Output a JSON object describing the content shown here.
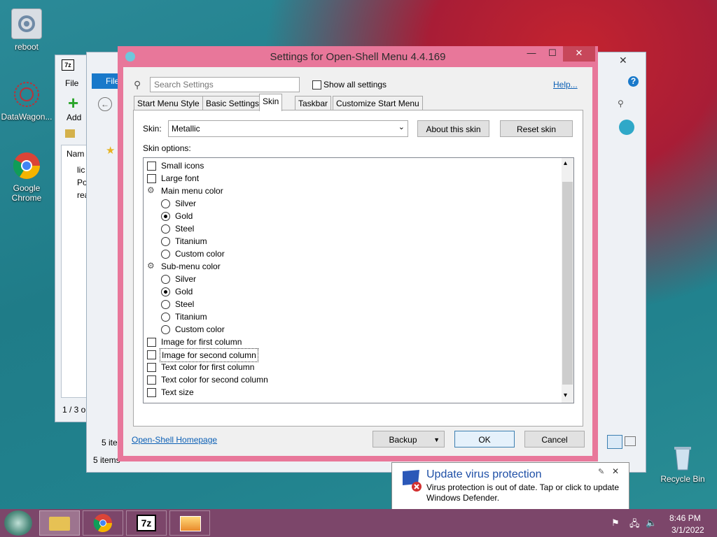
{
  "desktop": {
    "icons": [
      {
        "label": "reboot"
      },
      {
        "label": "DataWagon..."
      },
      {
        "label": "Google Chrome"
      },
      {
        "label": "Recycle Bin"
      }
    ]
  },
  "bg_window1": {
    "menu_file": "File",
    "add_label": "Add",
    "col_name": "Nam",
    "files": [
      "lic",
      "Po",
      "rea"
    ],
    "status": "1 / 3 o"
  },
  "bg_window2": {
    "menu_file": "File",
    "status1": "5 ite",
    "status2": "5 items"
  },
  "dialog": {
    "title": "Settings for Open-Shell Menu 4.4.169",
    "search_placeholder": "Search Settings",
    "show_all_label": "Show all settings",
    "help_link": "Help...",
    "tabs": [
      "Start Menu Style",
      "Basic Settings",
      "Skin",
      "Taskbar",
      "Customize Start Menu"
    ],
    "active_tab": "Skin",
    "skin_label": "Skin:",
    "skin_value": "Metallic",
    "about_skin": "About this skin",
    "reset_skin": "Reset skin",
    "skin_options_label": "Skin options:",
    "options": [
      {
        "kind": "check",
        "label": "Small icons",
        "indent": 0
      },
      {
        "kind": "check",
        "label": "Large font",
        "indent": 0
      },
      {
        "kind": "group",
        "label": "Main menu color",
        "indent": 0
      },
      {
        "kind": "radio",
        "label": "Silver",
        "indent": 1,
        "on": false
      },
      {
        "kind": "radio",
        "label": "Gold",
        "indent": 1,
        "on": true
      },
      {
        "kind": "radio",
        "label": "Steel",
        "indent": 1,
        "on": false
      },
      {
        "kind": "radio",
        "label": "Titanium",
        "indent": 1,
        "on": false
      },
      {
        "kind": "radio",
        "label": "Custom color",
        "indent": 1,
        "on": false
      },
      {
        "kind": "group",
        "label": "Sub-menu color",
        "indent": 0
      },
      {
        "kind": "radio",
        "label": "Silver",
        "indent": 1,
        "on": false
      },
      {
        "kind": "radio",
        "label": "Gold",
        "indent": 1,
        "on": true
      },
      {
        "kind": "radio",
        "label": "Steel",
        "indent": 1,
        "on": false
      },
      {
        "kind": "radio",
        "label": "Titanium",
        "indent": 1,
        "on": false
      },
      {
        "kind": "radio",
        "label": "Custom color",
        "indent": 1,
        "on": false
      },
      {
        "kind": "check",
        "label": "Image for first column",
        "indent": 0
      },
      {
        "kind": "check",
        "label": "Image for second column",
        "indent": 0,
        "selected": true
      },
      {
        "kind": "check",
        "label": "Text color for first column",
        "indent": 0
      },
      {
        "kind": "check",
        "label": "Text color for second column",
        "indent": 0
      },
      {
        "kind": "check",
        "label": "Text size",
        "indent": 0
      }
    ],
    "homepage_link": "Open-Shell Homepage",
    "backup": "Backup",
    "ok": "OK",
    "cancel": "Cancel"
  },
  "notification": {
    "title": "Update virus protection",
    "body": "Virus protection is out of date. Tap or click to update Windows Defender."
  },
  "taskbar": {
    "time": "8:46 PM",
    "date": "3/1/2022",
    "sevenzip_label": "7z"
  },
  "colors": {
    "dialog_frame": "#e8779a",
    "taskbar": "#7c466a",
    "link": "#0b5fb5"
  }
}
